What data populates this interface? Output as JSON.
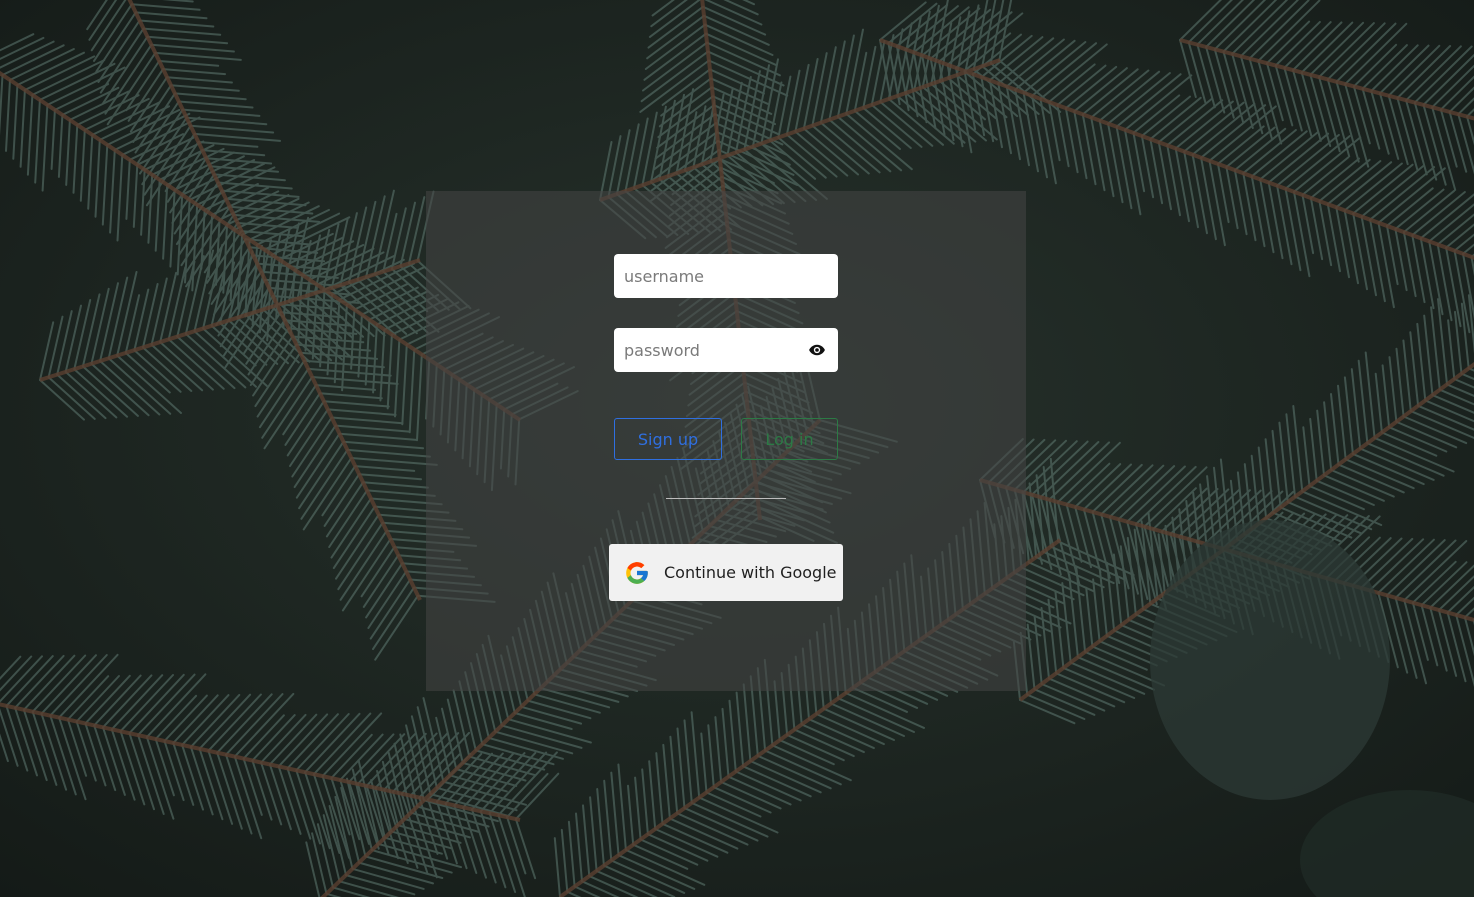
{
  "login_form": {
    "username": {
      "placeholder": "username",
      "value": ""
    },
    "password": {
      "placeholder": "password",
      "value": ""
    },
    "signup_label": "Sign up",
    "login_label": "Log in",
    "google_label": "Continue with Google"
  },
  "icons": {
    "password_toggle": "eye-icon",
    "google": "google-logo-icon"
  },
  "colors": {
    "signup": "#2f6fe0",
    "login": "#2c7a45",
    "card_overlay": "rgba(70,70,70,0.55)"
  }
}
